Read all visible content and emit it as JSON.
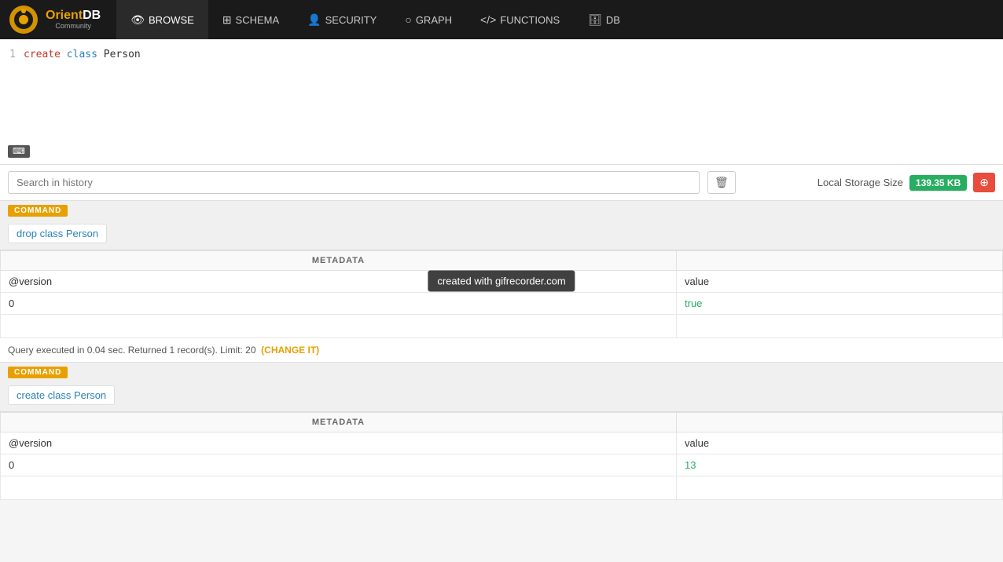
{
  "brand": {
    "orient": "Orient",
    "db": "DB",
    "community": "Community"
  },
  "nav": {
    "items": [
      {
        "id": "browse",
        "label": "BROWSE",
        "icon": "👁",
        "active": true
      },
      {
        "id": "schema",
        "label": "SCHEMA",
        "icon": "⊞",
        "active": false
      },
      {
        "id": "security",
        "label": "SECURITY",
        "icon": "👤",
        "active": false
      },
      {
        "id": "graph",
        "label": "GRAPH",
        "icon": "○",
        "active": false
      },
      {
        "id": "functions",
        "label": "FUNCTIONS",
        "icon": "</>",
        "active": false
      },
      {
        "id": "db",
        "label": "DB",
        "icon": "🗄",
        "active": false
      }
    ]
  },
  "editor": {
    "line_number": "1",
    "code_create": "create",
    "code_class": " class",
    "code_person": " Person"
  },
  "history": {
    "search_placeholder": "Search in history"
  },
  "storage": {
    "label": "Local Storage Size",
    "size": "139.35 KB",
    "clear_icon": "⊕"
  },
  "command1": {
    "badge": "COMMAND",
    "link_text": "drop class Person",
    "table": {
      "col1_header": "METADATA",
      "col2_header": "",
      "rows": [
        {
          "col1_label": "@version",
          "col2_label": "value"
        },
        {
          "col1_value": "0",
          "col2_value": "true",
          "col2_class": "value-true"
        }
      ]
    },
    "query_status": "Query executed in 0.04 sec. Returned 1 record(s). Limit: 20",
    "change_it": "(CHANGE IT)"
  },
  "command2": {
    "badge": "COMMAND",
    "link_text": "create class Person",
    "table": {
      "col1_header": "METADATA",
      "col2_header": "",
      "rows": [
        {
          "col1_label": "@version",
          "col2_label": "value"
        },
        {
          "col1_value": "0",
          "col2_value": "13",
          "col2_class": "value-num"
        }
      ]
    }
  },
  "watermark": "created with gifrecorder.com"
}
